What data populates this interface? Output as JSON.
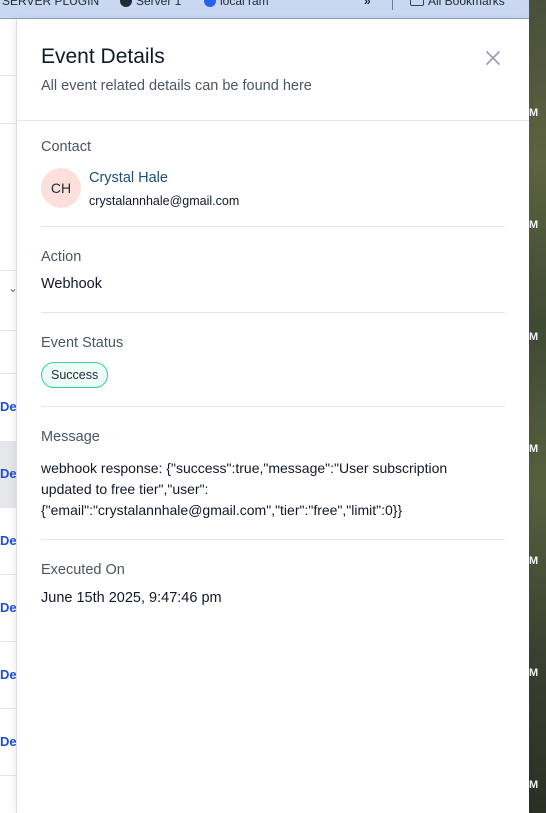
{
  "bookmarks": {
    "items": [
      "SERVER PLUGIN",
      "Server 1",
      "local ram"
    ],
    "overflow": "»",
    "all_bookmarks": "All Bookmarks"
  },
  "background": {
    "row_link_text": "Det",
    "time_suffix": "M"
  },
  "drawer": {
    "title": "Event Details",
    "subtitle": "All event related details can be found here",
    "close_icon": "close-icon",
    "contact": {
      "label": "Contact",
      "initials": "CH",
      "name": "Crystal Hale",
      "email": "crystalannhale@gmail.com",
      "avatar_color": "#fde0dc"
    },
    "action": {
      "label": "Action",
      "value": "Webhook"
    },
    "status": {
      "label": "Event Status",
      "value": "Success",
      "color": "#34d399"
    },
    "message": {
      "label": "Message",
      "value": "webhook response: {\"success\":true,\"message\":\"User subscription updated to free tier\",\"user\": {\"email\":\"crystalannhale@gmail.com\",\"tier\":\"free\",\"limit\":0}}"
    },
    "executed": {
      "label": "Executed On",
      "value": "June 15th 2025, 9:47:46 pm"
    }
  }
}
